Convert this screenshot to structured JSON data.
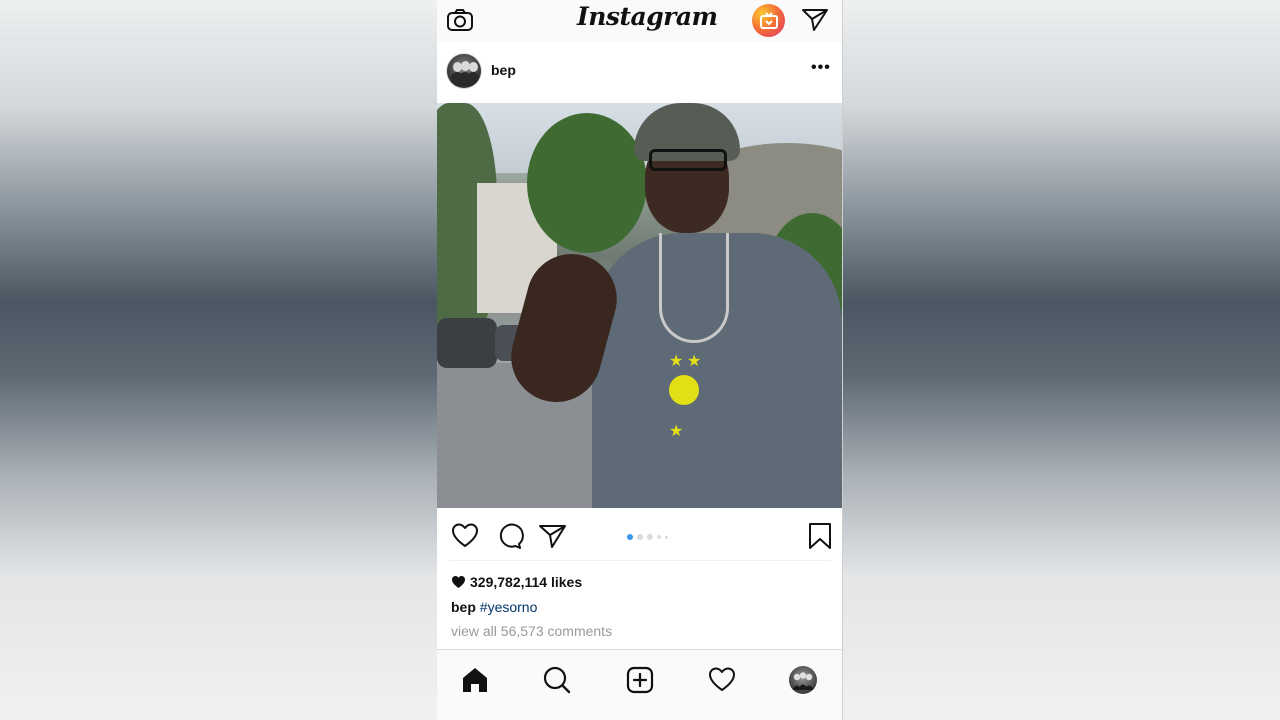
{
  "app": {
    "brand": "Instagram"
  },
  "topbar": {
    "camera_icon": "camera-icon",
    "igtv_icon": "igtv-icon",
    "direct_icon": "paper-plane-icon"
  },
  "post": {
    "username": "bep",
    "more_label": "•••",
    "carousel": {
      "total": 5,
      "active_index": 0
    },
    "likes_text": "329,782,114 likes",
    "caption_user": "bep",
    "caption_tag": "#yesorno",
    "comments_link": "view all 56,573 comments"
  },
  "actions": {
    "like_icon": "heart-outline-icon",
    "comment_icon": "comment-bubble-icon",
    "share_icon": "paper-plane-icon",
    "save_icon": "bookmark-icon"
  },
  "navbar": {
    "items": [
      "home-icon",
      "search-icon",
      "add-post-icon",
      "heart-icon",
      "profile-avatar"
    ]
  },
  "colors": {
    "accent_blue": "#3897f0",
    "hashtag": "#003569",
    "muted": "#999999"
  }
}
